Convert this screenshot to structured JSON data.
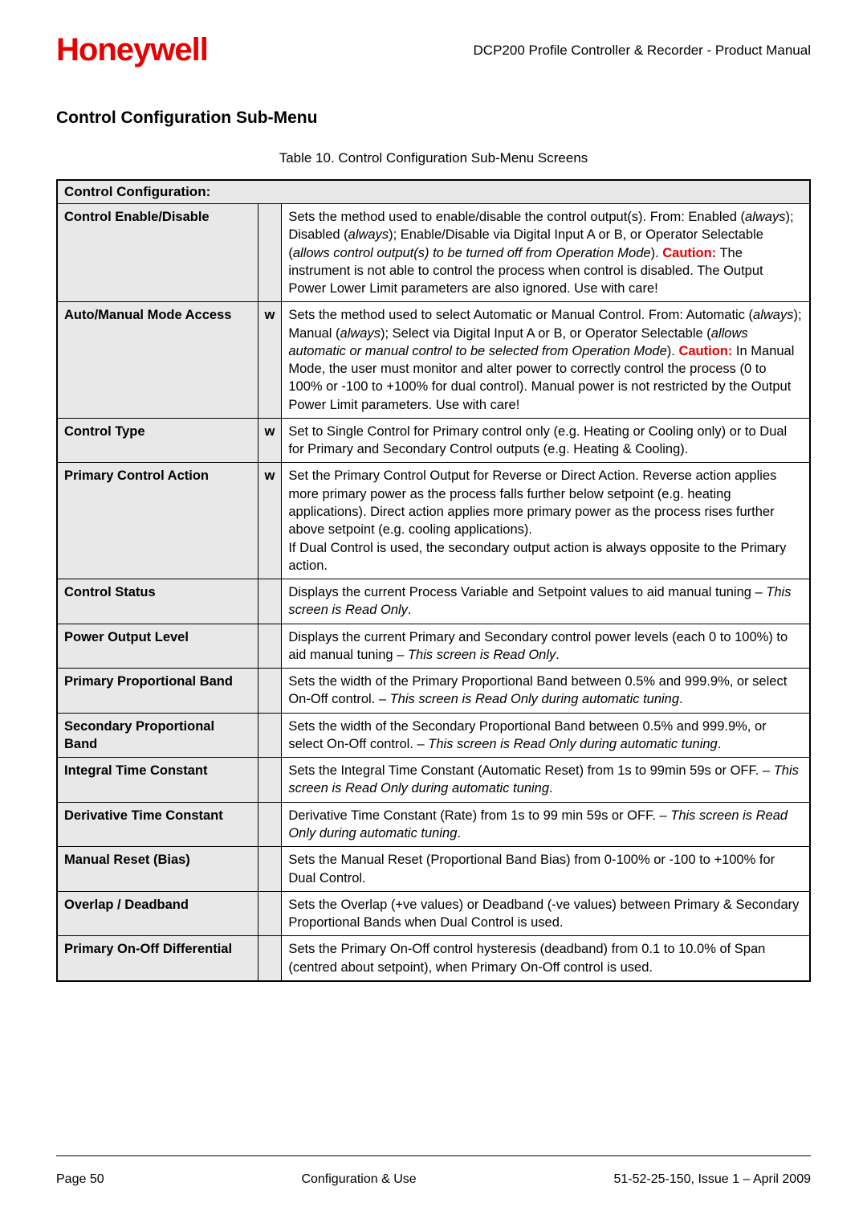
{
  "header": {
    "logo_text": "Honeywell",
    "doc_title": "DCP200 Profile Controller & Recorder - Product Manual"
  },
  "section_title": "Control Configuration Sub-Menu",
  "table_caption": "Table 10. Control Configuration Sub-Menu Screens",
  "table_title": "Control Configuration:",
  "rows": [
    {
      "name": "Control Enable/Disable",
      "flag": "",
      "desc_pre": "Sets the method used to enable/disable the control output(s). From: Enabled (",
      "desc_i1": "always",
      "desc_mid1": "); Disabled (",
      "desc_i2": "always",
      "desc_mid2": "); Enable/Disable via Digital Input A or B, or Operator Selectable (",
      "desc_i3": "allows control output(s) to be turned off from Operation Mode",
      "desc_mid3": "). ",
      "caution": "Caution:",
      "desc_post": " The instrument is not able to control the process when control is disabled. The Output Power Lower Limit parameters are also ignored. Use with care!"
    },
    {
      "name": "Auto/Manual Mode Access",
      "flag": "w",
      "desc_pre": "Sets the method used to select Automatic or Manual Control. From: Automatic (",
      "desc_i1": "always",
      "desc_mid1": "); Manual (",
      "desc_i2": "always",
      "desc_mid2": "); Select via Digital Input A or B, or Operator Selectable (",
      "desc_i3": "allows automatic or manual control to be selected from Operation Mode",
      "desc_mid3": "). ",
      "caution": "Caution:",
      "desc_post": " In Manual Mode, the user must monitor and alter power to correctly control the process (0 to 100% or -100 to +100% for dual control). Manual power is not restricted by the Output Power Limit parameters. Use with care!"
    },
    {
      "name": "Control Type",
      "flag": "w",
      "desc": "Set to Single Control for Primary control only (e.g. Heating or Cooling only) or to Dual for Primary and Secondary Control outputs (e.g. Heating & Cooling)."
    },
    {
      "name": "Primary Control Action",
      "flag": "w",
      "desc": "Set the Primary Control Output for Reverse or Direct Action. Reverse action applies more primary power as the process falls further below setpoint (e.g. heating applications). Direct action applies more primary power as the process rises further above setpoint (e.g. cooling applications).\nIf Dual Control is used, the secondary output action is always opposite to the Primary action."
    },
    {
      "name": "Control Status",
      "flag": "",
      "desc_pre": "Displays the current Process Variable and Setpoint values to aid manual tuning – ",
      "desc_i1": "This screen is Read Only",
      "desc_post": "."
    },
    {
      "name": "Power Output Level",
      "flag": "",
      "desc_pre": "Displays the current Primary and Secondary control power levels (each 0 to 100%) to aid manual tuning – ",
      "desc_i1": "This screen is Read Only",
      "desc_post": "."
    },
    {
      "name": "Primary Proportional Band",
      "flag": "",
      "desc_pre": "Sets the width of the Primary Proportional Band between 0.5% and 999.9%, or select On-Off control. – ",
      "desc_i1": "This screen is Read Only during automatic tuning",
      "desc_post": "."
    },
    {
      "name": "Secondary Proportional Band",
      "flag": "",
      "desc_pre": "Sets the width of the Secondary Proportional Band between 0.5% and 999.9%, or select On-Off control. – ",
      "desc_i1": "This screen is Read Only during automatic tuning",
      "desc_post": "."
    },
    {
      "name": "Integral Time Constant",
      "flag": "",
      "desc_pre": "Sets the Integral Time Constant (Automatic Reset) from 1s to 99min 59s or OFF. – ",
      "desc_i1": "This screen is Read Only during automatic tuning",
      "desc_post": "."
    },
    {
      "name": "Derivative Time Constant",
      "flag": "",
      "desc_pre": "Derivative Time Constant (Rate) from 1s to 99 min 59s or OFF. – ",
      "desc_i1": "This screen is Read Only during automatic tuning",
      "desc_post": "."
    },
    {
      "name": "Manual Reset (Bias)",
      "flag": "",
      "desc": "Sets the Manual Reset (Proportional Band Bias) from 0-100% or -100 to +100% for Dual Control."
    },
    {
      "name": "Overlap / Deadband",
      "flag": "",
      "desc": "Sets the Overlap (+ve values) or Deadband (-ve values) between Primary & Secondary Proportional Bands when Dual Control is used."
    },
    {
      "name": "Primary On-Off Differential",
      "flag": "",
      "desc": "Sets the Primary On-Off control hysteresis (deadband) from 0.1 to 10.0% of Span (centred about setpoint), when Primary On-Off control is used."
    }
  ],
  "footer": {
    "left": "Page 50",
    "center": "Configuration & Use",
    "right": "51-52-25-150, Issue 1 – April 2009"
  }
}
